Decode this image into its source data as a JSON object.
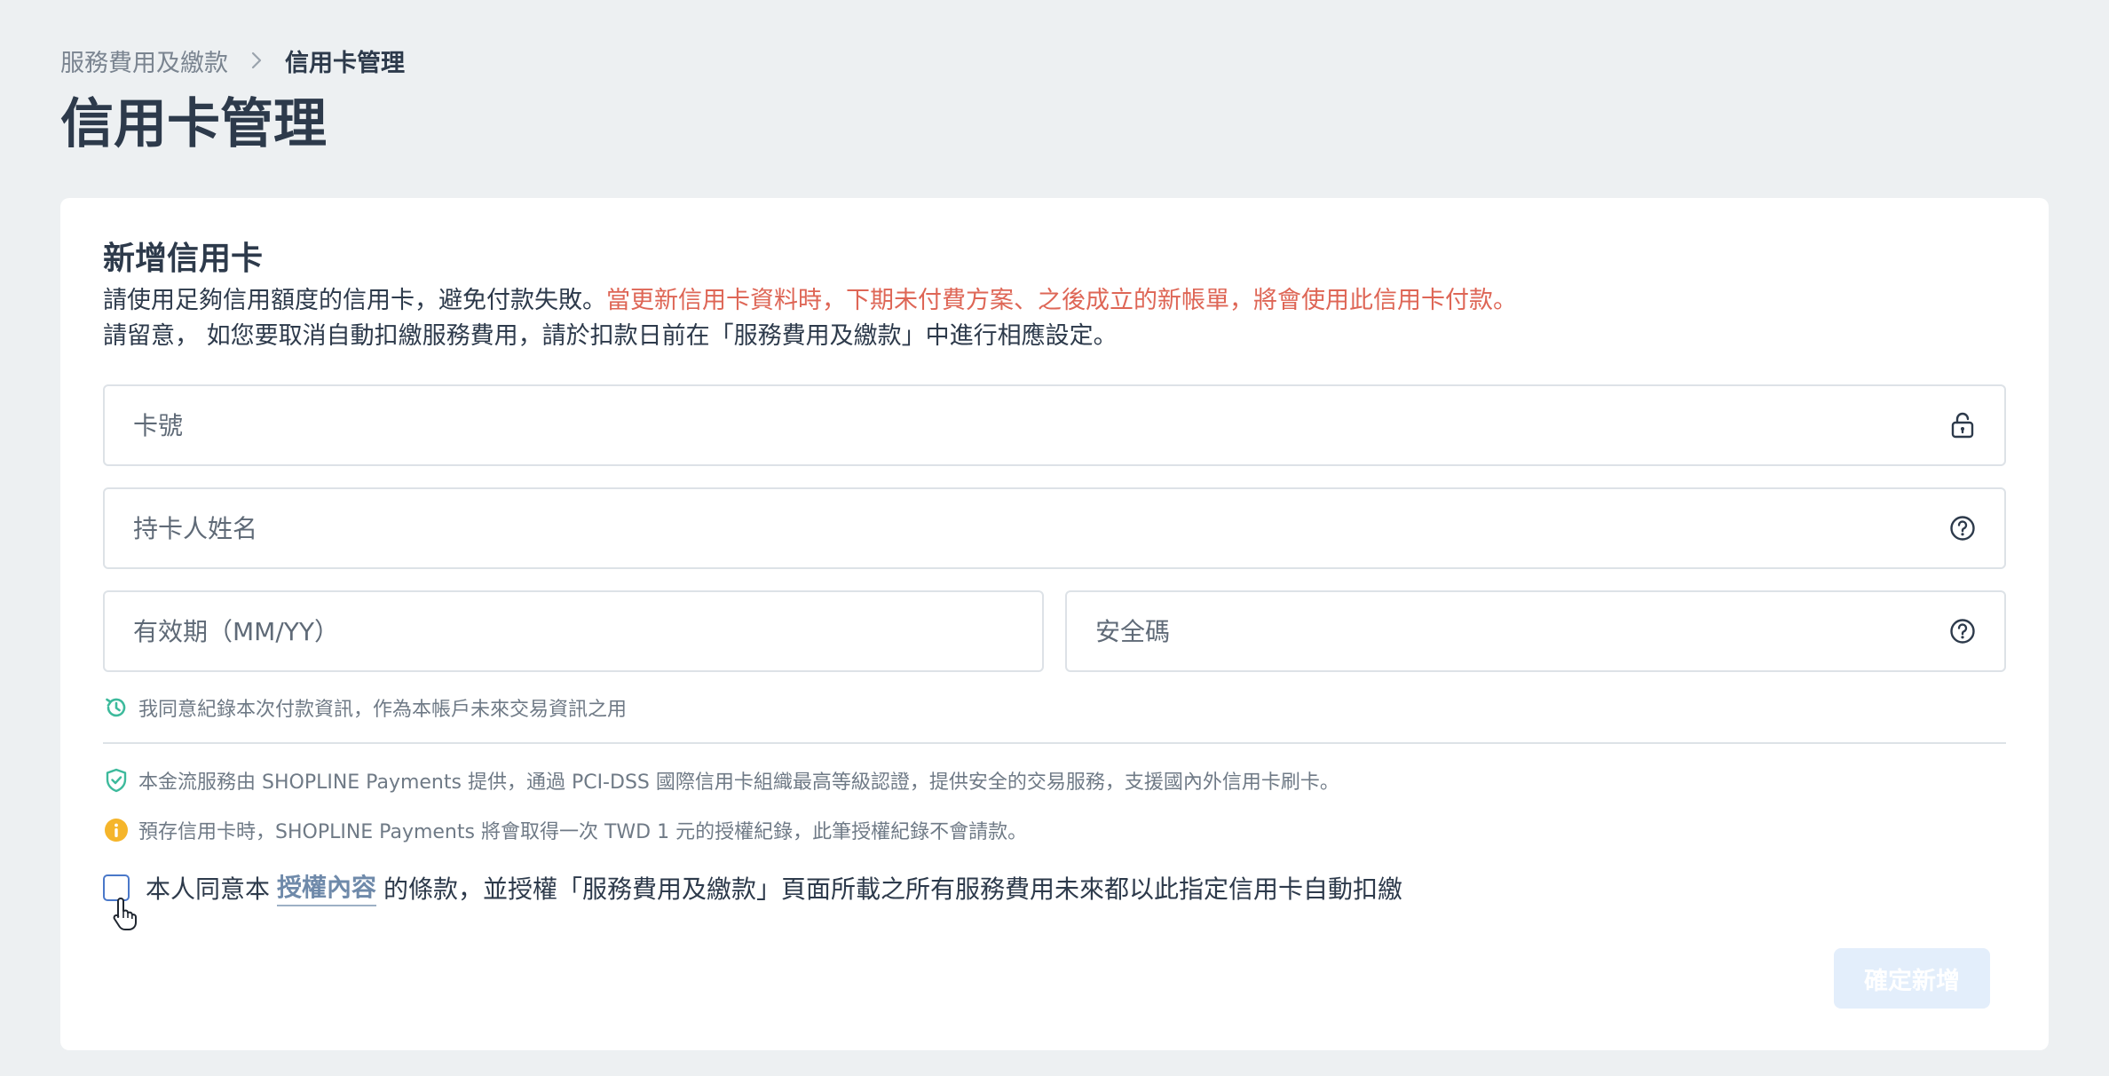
{
  "breadcrumb": {
    "parent": "服務費用及繳款",
    "current": "信用卡管理"
  },
  "page": {
    "title": "信用卡管理"
  },
  "card": {
    "title": "新增信用卡",
    "desc_line1_normal": "請使用足夠信用額度的信用卡，避免付款失敗。",
    "desc_line1_warning": "當更新信用卡資料時，下期未付費方案、之後成立的新帳單，將會使用此信用卡付款。",
    "desc_line2": "請留意， 如您要取消自動扣繳服務費用，請於扣款日前在「服務費用及繳款」中進行相應設定。"
  },
  "form": {
    "card_number_placeholder": "卡號",
    "card_number_value": "",
    "holder_name_placeholder": "持卡人姓名",
    "holder_name_value": "",
    "expiry_placeholder": "有效期（MM/YY）",
    "expiry_value": "",
    "cvv_placeholder": "安全碼",
    "cvv_value": ""
  },
  "notes": {
    "remember": "我同意紀錄本次付款資訊，作為本帳戶未來交易資訊之用",
    "secure": "本金流服務由 SHOPLINE Payments 提供，通過 PCI-DSS 國際信用卡組織最高等級認證，提供安全的交易服務，支援國內外信用卡刷卡。",
    "info": "預存信用卡時，SHOPLINE Payments 將會取得一次 TWD 1 元的授權紀錄，此筆授權紀錄不會請款。"
  },
  "agreement": {
    "before": "本人同意本",
    "link": "授權內容",
    "after": "的條款，並授權「服務費用及繳款」頁面所載之所有服務費用未來都以此指定信用卡自動扣繳",
    "checked": false
  },
  "actions": {
    "submit_label": "確定新增"
  },
  "colors": {
    "background": "#edf0f2",
    "warning_text": "#de6656",
    "success_icon": "#3dba9c",
    "info_icon": "#f5b52b",
    "link_text": "#6f8aaa",
    "submit_disabled_bg": "#e3eefb"
  },
  "icons": {
    "card_number": "lock-icon",
    "holder_name": "help-circle-icon",
    "cvv": "help-circle-icon",
    "remember": "history-icon",
    "secure": "shield-check-icon",
    "info": "info-icon"
  }
}
